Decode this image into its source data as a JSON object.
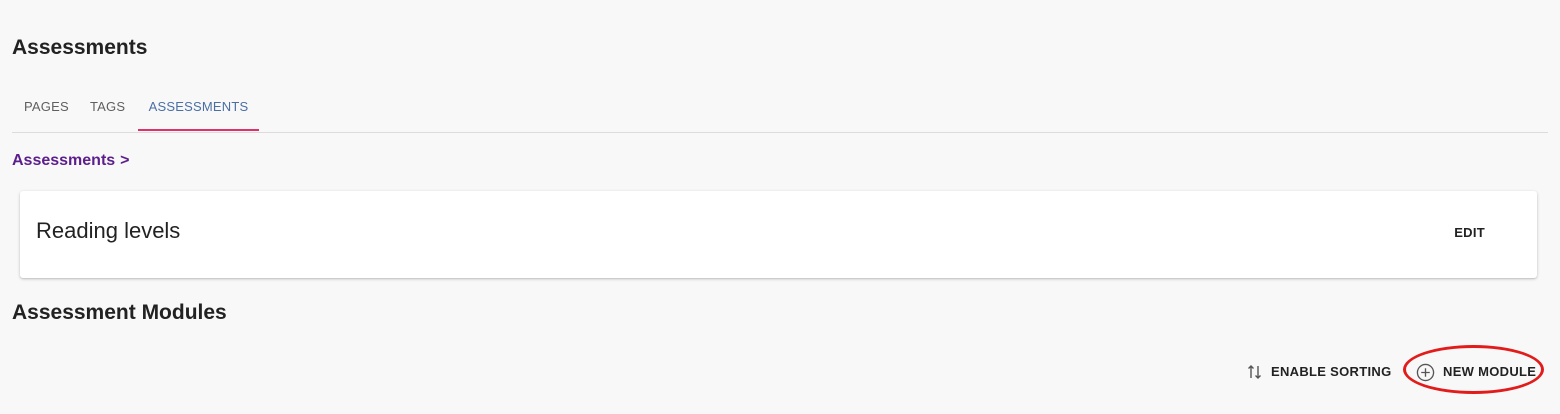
{
  "header": {
    "title": "Assessments"
  },
  "tabs": [
    {
      "label": "PAGES"
    },
    {
      "label": "TAGS"
    },
    {
      "label": "ASSESSMENTS",
      "active": true
    }
  ],
  "breadcrumb": {
    "label": "Assessments",
    "separator": ">"
  },
  "card": {
    "title": "Reading levels",
    "edit_label": "EDIT"
  },
  "modules": {
    "title": "Assessment Modules",
    "enable_sorting_label": "ENABLE SORTING",
    "new_module_label": "NEW MODULE"
  },
  "colors": {
    "background": "#f8f8f8",
    "active_tab_text": "#4a6fa5",
    "active_tab_indicator": "#e0306b",
    "breadcrumb": "#5b1e8c",
    "annotation": "#e21b1b"
  },
  "icons": {
    "sort": "swap-vertical-icon",
    "new_module": "add-circle-icon"
  }
}
